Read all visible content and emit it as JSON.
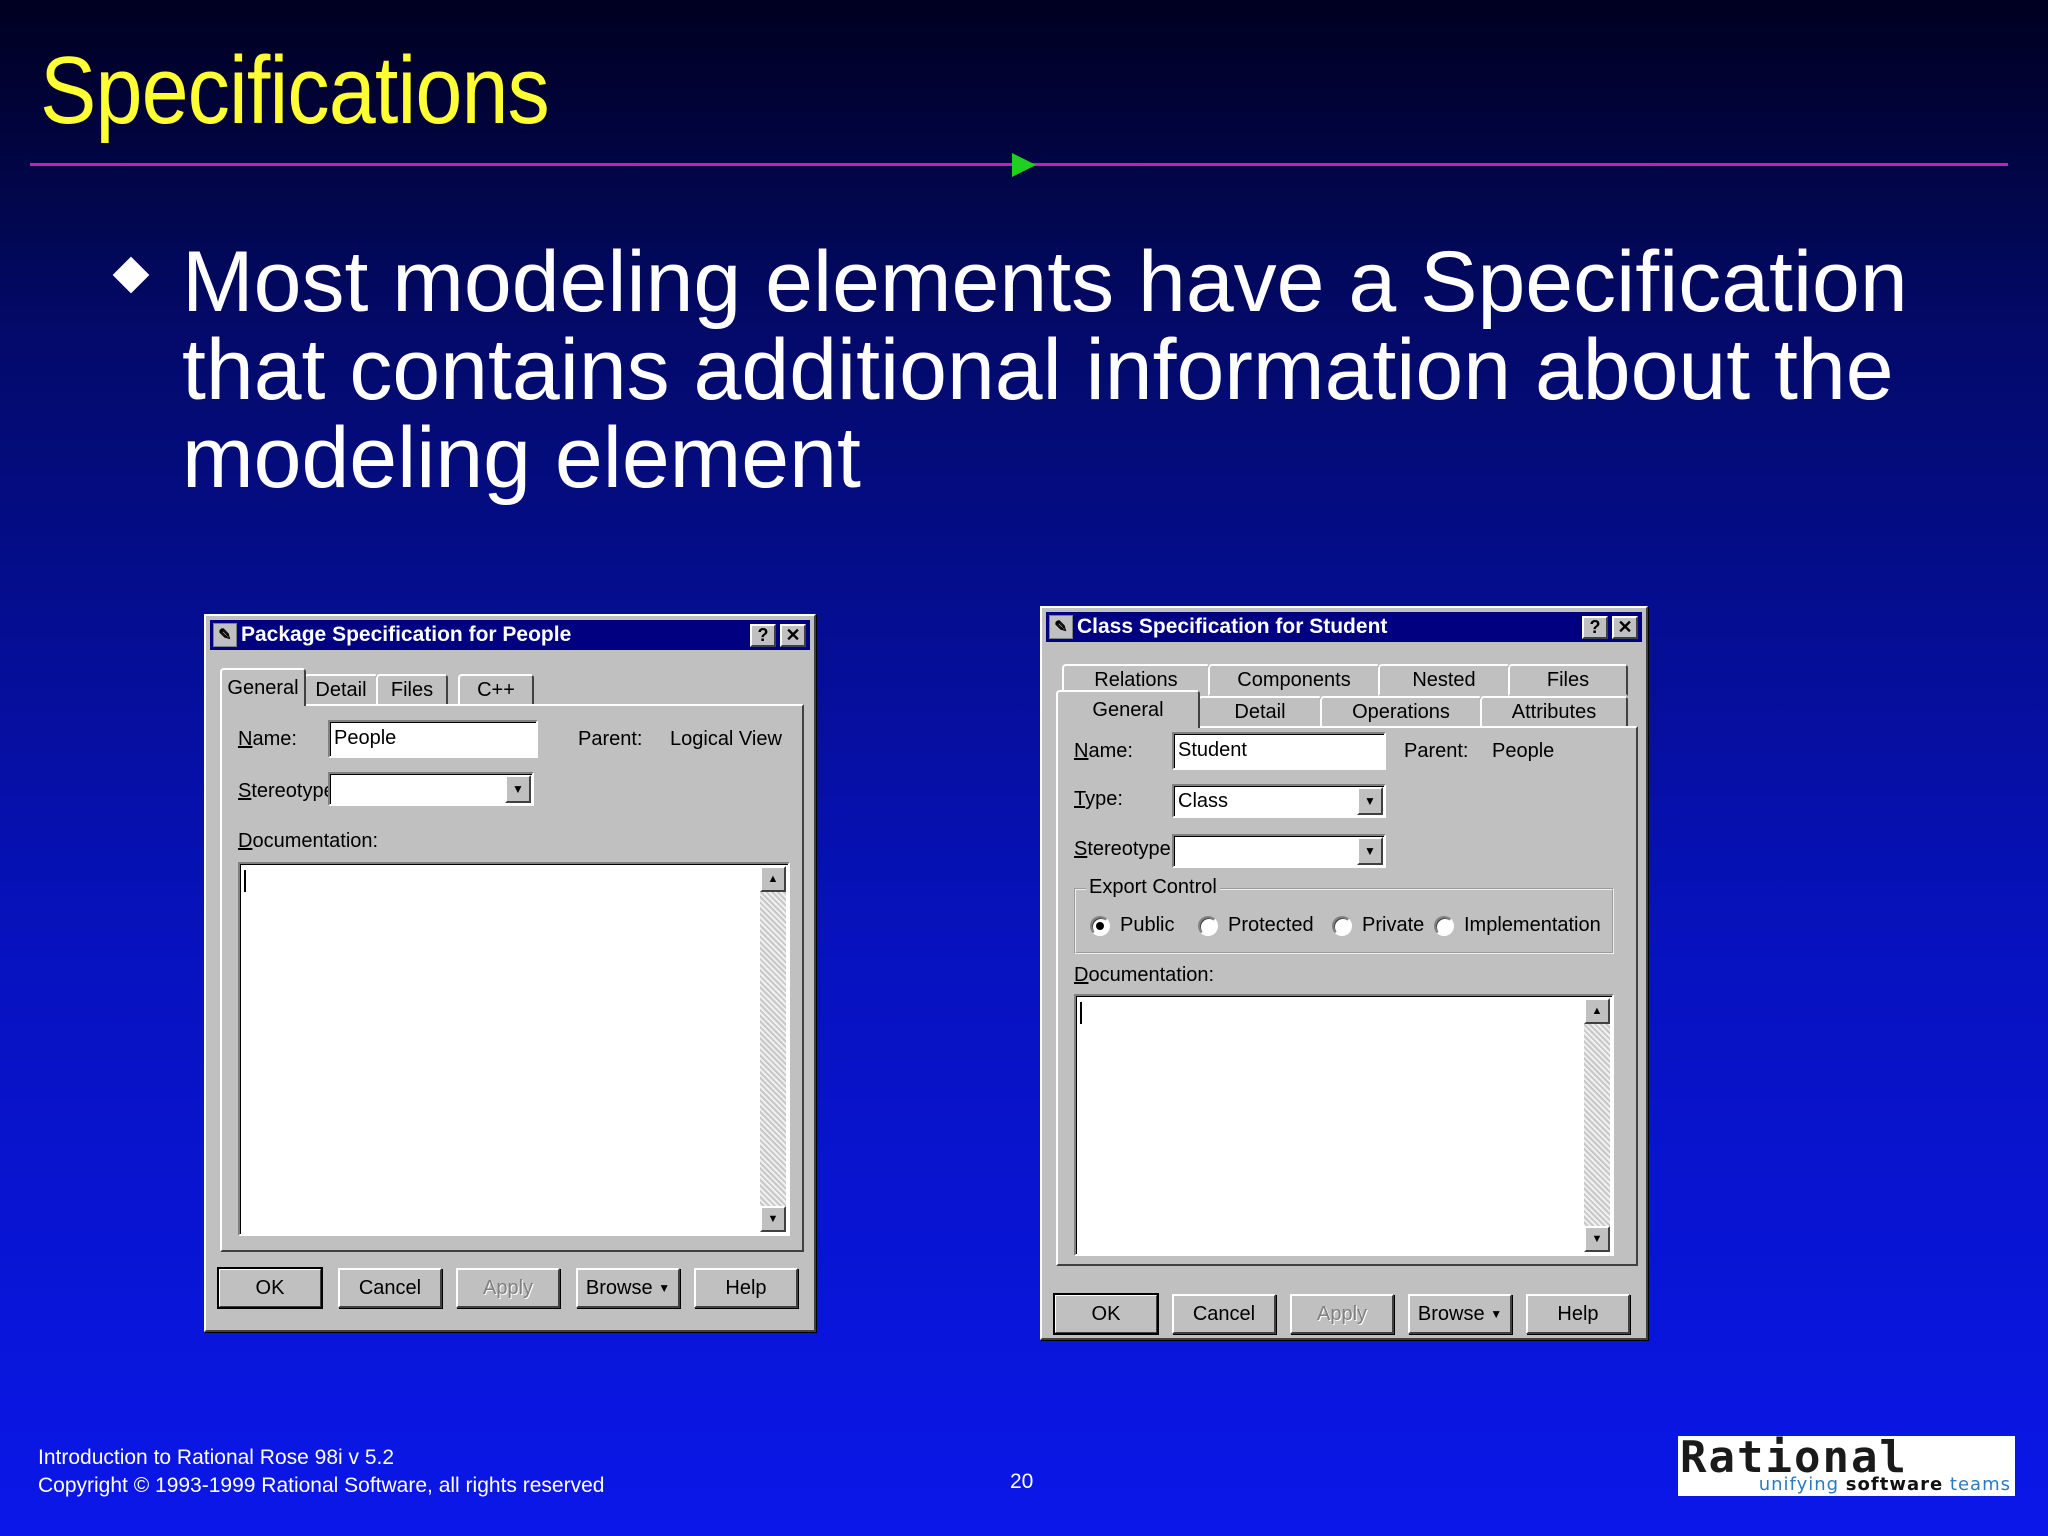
{
  "slide": {
    "title": "Specifications",
    "bullet": "Most modeling elements have a Specification that contains additional information about the modeling element",
    "page_number": "20",
    "footer_line1": "Introduction to Rational Rose 98i  v 5.2",
    "footer_line2": "Copyright © 1993-1999 Rational Software, all rights reserved"
  },
  "logo": {
    "word": "Rational",
    "tagline_a": "unifying",
    "tagline_b": "software",
    "tagline_c": "teams"
  },
  "colors": {
    "title": "#ffff33",
    "rule": "#c020c0",
    "arrow": "#20d020",
    "titlebar": "#000080"
  },
  "package_dialog": {
    "title": "Package Specification for People",
    "help_btn": "?",
    "close_btn": "✕",
    "tabs": [
      "General",
      "Detail",
      "Files",
      "C++"
    ],
    "active_tab": "General",
    "name_label": "Name:",
    "name_value": "People",
    "parent_label": "Parent:",
    "parent_value": "Logical View",
    "stereotype_label": "Stereotype:",
    "stereotype_value": "",
    "documentation_label": "Documentation:",
    "buttons": {
      "ok": "OK",
      "cancel": "Cancel",
      "apply": "Apply",
      "browse": "Browse",
      "help": "Help"
    }
  },
  "class_dialog": {
    "title": "Class Specification for Student",
    "help_btn": "?",
    "close_btn": "✕",
    "tabs_row1": [
      "Relations",
      "Components",
      "Nested",
      "Files"
    ],
    "tabs_row2": [
      "General",
      "Detail",
      "Operations",
      "Attributes"
    ],
    "active_tab": "General",
    "name_label": "Name:",
    "name_value": "Student",
    "parent_label": "Parent:",
    "parent_value": "People",
    "type_label": "Type:",
    "type_value": "Class",
    "stereotype_label": "Stereotype:",
    "stereotype_value": "",
    "export_control_label": "Export Control",
    "export_options": [
      "Public",
      "Protected",
      "Private",
      "Implementation"
    ],
    "export_selected": "Public",
    "documentation_label": "Documentation:",
    "buttons": {
      "ok": "OK",
      "cancel": "Cancel",
      "apply": "Apply",
      "browse": "Browse",
      "help": "Help"
    }
  }
}
